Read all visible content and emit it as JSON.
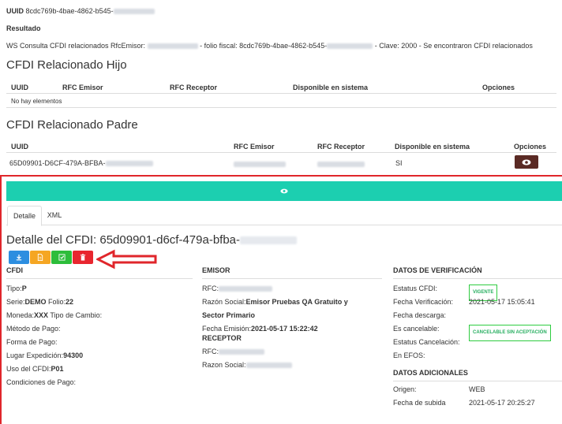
{
  "header": {
    "uuid_label": "UUID",
    "uuid_value": "8cdc769b-4bae-4862-b545-",
    "resultado_label": "Resultado",
    "ws_text_1": "WS Consulta CFDI relacionados RfcEmisor:",
    "ws_text_2": "- folio fiscal: 8cdc769b-4bae-4862-b545-",
    "ws_text_3": "- Clave: 2000 - Se encontraron CFDI relacionados"
  },
  "hijo": {
    "title": "CFDI Relacionado Hijo",
    "columns": [
      "UUID",
      "RFC Emisor",
      "RFC Receptor",
      "Disponible en sistema",
      "Opciones"
    ],
    "empty": "No hay elementos"
  },
  "padre": {
    "title": "CFDI Relacionado Padre",
    "columns": [
      "UUID",
      "RFC Emisor",
      "RFC Receptor",
      "Disponible en sistema",
      "Opciones"
    ],
    "row": {
      "uuid": "65D09901-D6CF-479A-BFBA-",
      "disponible": "SI"
    }
  },
  "tabs": [
    "Detalle",
    "XML"
  ],
  "detalle": {
    "title": "Detalle del CFDI: 65d09901-d6cf-479a-bfba-"
  },
  "cfdi": {
    "heading": "CFDI",
    "tipo_label": "Tipo:",
    "tipo_value": "P",
    "serie_label": "Serie:",
    "serie_value": "DEMO",
    "folio_label": "Folio:",
    "folio_value": "22",
    "moneda_label": "Moneda:",
    "moneda_value": "XXX",
    "tipo_cambio_label": "Tipo de Cambio:",
    "metodo_pago": "Método de Pago:",
    "forma_pago": "Forma de Pago:",
    "lugar_label": "Lugar Expedición:",
    "lugar_value": "94300",
    "uso_label": "Uso del CFDI:",
    "uso_value": "P01",
    "condiciones": "Condiciones de Pago:"
  },
  "emisor": {
    "heading": "EMISOR",
    "rfc_label": "RFC:",
    "razon_label": "Razón Social:",
    "razon_value_1": "Emisor Pruebas QA Gratuito y",
    "razon_value_2": "Sector Primario",
    "fecha_label": "Fecha Emisión:",
    "fecha_value": "2021-05-17 15:22:42",
    "receptor_heading": "RECEPTOR",
    "receptor_rfc_label": "RFC:",
    "receptor_razon_label": "Razon Social:"
  },
  "verificacion": {
    "heading": "DATOS DE VERIFICACIÓN",
    "estatus_label": "Estatus CFDI:",
    "estatus_badge": "VIGENTE",
    "fecha_verif_label": "Fecha Verificación:",
    "fecha_verif_value": "2021-05-17 15:05:41",
    "fecha_descarga_label": "Fecha descarga:",
    "cancelable_label": "Es cancelable:",
    "cancelable_badge": "CANCELABLE SIN ACEPTACIÓN",
    "estatus_cancel_label": "Estatus Cancelación:",
    "efos_label": "En EFOS:"
  },
  "adicionales": {
    "heading": "DATOS ADICIONALES",
    "origen_label": "Origen:",
    "origen_value": "WEB",
    "subida_label": "Fecha de subida",
    "subida_value": "2021-05-17 20:25:27"
  },
  "colors": {
    "teal": "#1ccfb0",
    "blue": "#2d8ee0",
    "orange": "#f5a623",
    "green": "#2dbd3a",
    "red": "#e8262f",
    "dark_button": "#5a2a24",
    "annotation_red": "#e0262b"
  }
}
